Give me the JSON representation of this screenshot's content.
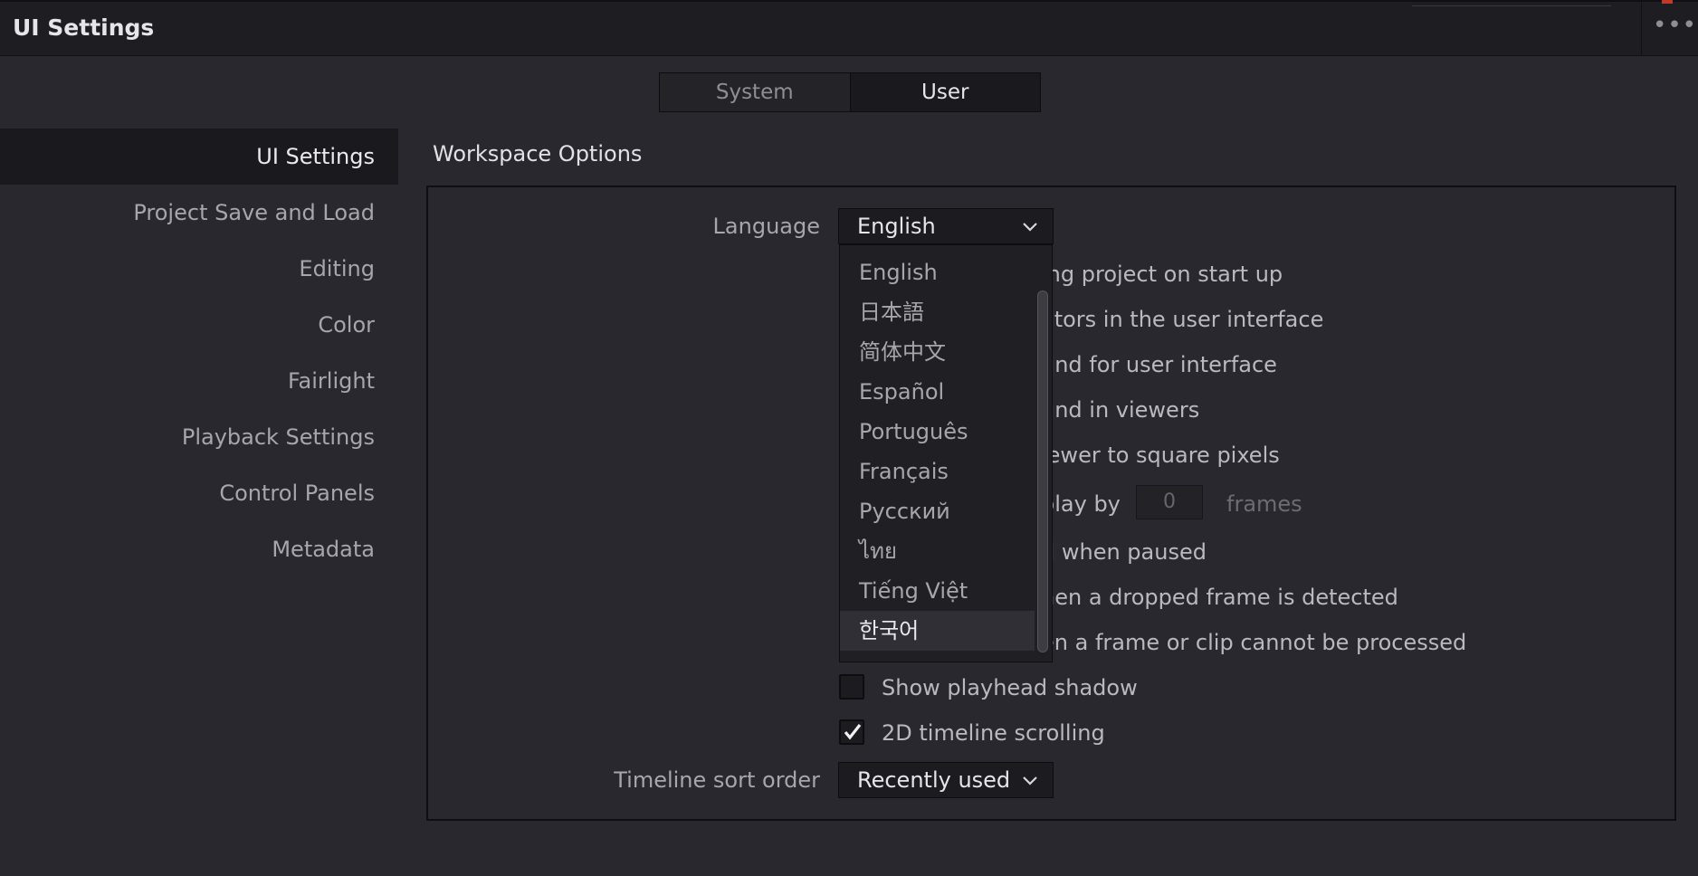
{
  "window": {
    "title": "UI Settings",
    "more_glyph": "•••"
  },
  "tabs": [
    {
      "label": "System"
    },
    {
      "label": "User"
    }
  ],
  "sidebar": {
    "items": [
      {
        "label": "UI Settings"
      },
      {
        "label": "Project Save and Load"
      },
      {
        "label": "Editing"
      },
      {
        "label": "Color"
      },
      {
        "label": "Fairlight"
      },
      {
        "label": "Playback Settings"
      },
      {
        "label": "Control Panels"
      },
      {
        "label": "Metadata"
      }
    ]
  },
  "section": {
    "title": "Workspace Options"
  },
  "language": {
    "label": "Language",
    "value": "English"
  },
  "language_options": [
    "English",
    "日本語",
    "简体中文",
    "Español",
    "Português",
    "Français",
    "Русский",
    "ไทย",
    "Tiếng Việt",
    "한국어"
  ],
  "partial_options": [
    "ing project on start up",
    "ators in the user interface",
    "und for user interface",
    "und in viewers",
    "iewer to square pixels",
    "play by",
    "d when paused",
    "hen a dropped frame is detected",
    "en a frame or clip cannot be processed"
  ],
  "delay": {
    "value": "0",
    "unit": "frames"
  },
  "checkboxes": [
    {
      "label": "Show playhead shadow",
      "checked": false
    },
    {
      "label": "2D timeline scrolling",
      "checked": true
    }
  ],
  "sort_order": {
    "label": "Timeline sort order",
    "value": "Recently used"
  }
}
